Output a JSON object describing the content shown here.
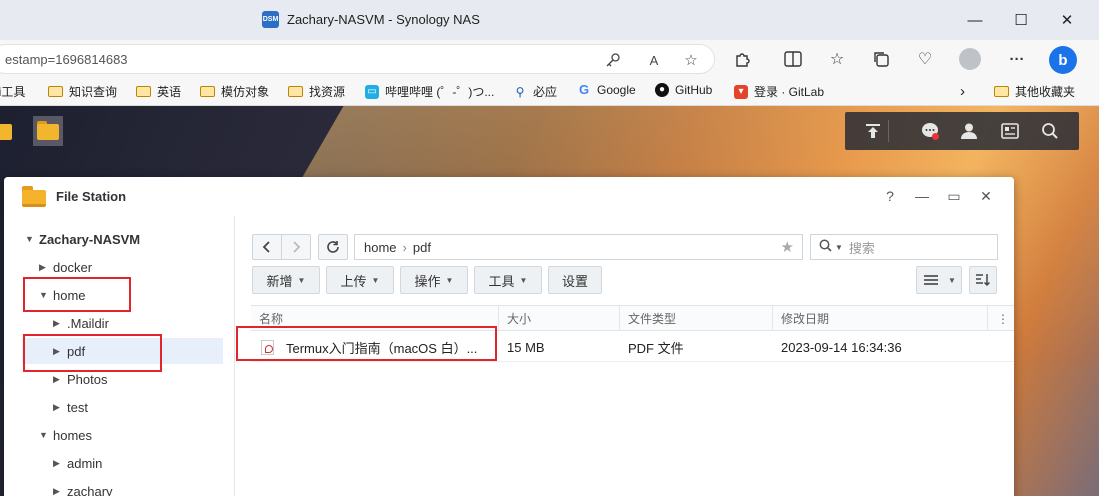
{
  "browser": {
    "title": "Zachary-NASVM - Synology NAS",
    "tab_badge": "DSM",
    "address_text": "estamp=1696814683",
    "controls": {
      "minimize": "—",
      "maximize": "☐",
      "close": "✕"
    },
    "read_aloud_label": "A",
    "toolbar_icons": [
      "extensions-icon",
      "split-screen-icon",
      "favorites-icon",
      "collections-icon",
      "browser-essentials-icon",
      "profile-icon",
      "more-icon",
      "bing-icon"
    ],
    "more_label": "···",
    "bing_label": "b"
  },
  "bookmarks": {
    "items": [
      {
        "label": "ai工具",
        "icon": "folder-icon"
      },
      {
        "label": "知识查询",
        "icon": "folder-icon"
      },
      {
        "label": "英语",
        "icon": "folder-icon"
      },
      {
        "label": "模仿对象",
        "icon": "folder-icon"
      },
      {
        "label": "找资源",
        "icon": "folder-icon"
      },
      {
        "label": "哔哩哔哩 (゜-゜)つ...",
        "icon": "bilibili-icon"
      },
      {
        "label": "必应",
        "icon": "search-icon"
      },
      {
        "label": "Google",
        "icon": "google-icon"
      },
      {
        "label": "GitHub",
        "icon": "github-icon"
      },
      {
        "label": "登录 · GitLab",
        "icon": "gitlab-icon"
      }
    ],
    "overflow_label": "›",
    "other_label": "其他收藏夹"
  },
  "file_station": {
    "title": "File Station",
    "controls": {
      "help": "?",
      "minimize": "—",
      "maximize": "▭",
      "close": "✕"
    },
    "tree": {
      "root": "Zachary-NASVM",
      "nodes": [
        "docker",
        "home",
        ".Maildir",
        "pdf",
        "Photos",
        "test",
        "homes",
        "admin",
        "zachary"
      ]
    },
    "path": {
      "segment1": "home",
      "separator": "›",
      "segment2": "pdf"
    },
    "search_placeholder": "搜索",
    "buttons": {
      "create": "新增",
      "upload": "上传",
      "action": "操作",
      "tools": "工具",
      "settings": "设置"
    },
    "columns": [
      "名称",
      "大小",
      "文件类型",
      "修改日期"
    ],
    "files": [
      {
        "name": "Termux入门指南（macOS 白）...",
        "size": "15 MB",
        "type": "PDF 文件",
        "modified": "2023-09-14 16:34:36"
      }
    ]
  },
  "colors": {
    "highlight": "#e0262b",
    "selection": "#e7f0fa",
    "accent": "#2d6fc7"
  }
}
